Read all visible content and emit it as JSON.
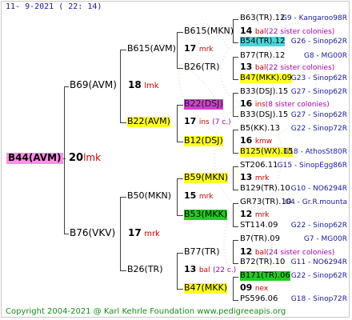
{
  "header": {
    "date": "11-  9-2021  ( 22:  14)"
  },
  "footer": {
    "copyright": "Copyright 2004-2021 @ Karl Kehrle Foundation    www.pedigreeapis.org"
  },
  "root": {
    "label": "B44(AVM)",
    "gen": {
      "num": "20",
      "abbr": "lmk"
    }
  },
  "gen1": {
    "sire": {
      "label": "B69(AVM)",
      "gen": {
        "num": "18",
        "abbr": "lmk"
      }
    },
    "dam": {
      "label": "B76(VKV)",
      "gen": {
        "num": "17",
        "abbr": "mrk"
      }
    }
  },
  "gen2": [
    {
      "label": "B615(AVM)",
      "gen": {
        "num": "17",
        "abbr": "mrk",
        "note": ""
      }
    },
    {
      "label": "B22(AVM)",
      "gen": {
        "num": "17",
        "abbr": "ins",
        "note": "(7 c.)"
      }
    },
    {
      "label": "B50(MKN)",
      "gen": {
        "num": "15",
        "abbr": "mrk",
        "note": ""
      }
    },
    {
      "label": "B26(TR)",
      "gen": {
        "num": "13",
        "abbr": "bal",
        "note": "(22 c.)"
      }
    }
  ],
  "gen3": [
    {
      "label": "B615(MKN)",
      "gen": {
        "num": "14",
        "abbr": "bal",
        "note": "(22 sister colonies)"
      }
    },
    {
      "label": "B26(TR)",
      "gen": {
        "num": "13",
        "abbr": "bal",
        "note": "(22 sister colonies)"
      }
    },
    {
      "label": "B22(DSJ)",
      "gen": {
        "num": "16",
        "abbr": "ins",
        "note": "(8 sister colonies)"
      }
    },
    {
      "label": "B12(DSJ)",
      "gen": {
        "num": "16",
        "abbr": "kmw",
        "note": ""
      }
    },
    {
      "label": "B59(MKN)",
      "gen": {
        "num": "13",
        "abbr": "mrk",
        "note": ""
      }
    },
    {
      "label": "B53(MKK)",
      "gen": {
        "num": "12",
        "abbr": "mrk",
        "note": ""
      }
    },
    {
      "label": "B77(TR)",
      "gen": {
        "num": "12",
        "abbr": "bal",
        "note": "(24 sister colonies)"
      }
    },
    {
      "label": "B47(MKK)",
      "gen": {
        "num": "09",
        "abbr": "nex",
        "note": ""
      }
    }
  ],
  "gen4": [
    {
      "name": "B63(TR).12",
      "code": "G9 - Kangaroo98R"
    },
    {
      "name": "B54(TR).12",
      "code": "G26 - Sinop62R"
    },
    {
      "name": "B77(TR).12",
      "code": "G8 - MG00R"
    },
    {
      "name": "B47(MKK).09",
      "code": "G23 - Sinop62R"
    },
    {
      "name": "B33(DSJ).15",
      "code": "G27 - Sinop62R"
    },
    {
      "name": "B33(DSJ).15",
      "code": "G27 - Sinop62R"
    },
    {
      "name": "B5(KK).13",
      "code": "G22 - Sinop72R"
    },
    {
      "name": "B125(WX).15",
      "code": "G18 - AthosSt80R"
    },
    {
      "name": "ST206.11",
      "code": "G15 - SinopEgg86R"
    },
    {
      "name": "B129(TR).10",
      "code": "G10 - NO6294R"
    },
    {
      "name": "GR73(TR).10",
      "code": "G4 - Gr.R.mounta"
    },
    {
      "name": "ST114.09",
      "code": "G22 - Sinop62R"
    },
    {
      "name": "B7(TR).09",
      "code": "G7 - MG00R"
    },
    {
      "name": "B72(TR).10",
      "code": "G11 - NO6294R"
    },
    {
      "name": "B171(TR).06",
      "code": "G22 - Sinop62R"
    },
    {
      "name": "PS596.06",
      "code": "G18 - Sinop72R"
    }
  ],
  "colors": {
    "pink": "#ff8fe8",
    "magenta": "#d040d0",
    "yellow": "#ffff22",
    "green": "#22cc22",
    "cyan": "#44d8d8",
    "codeBlue": "#1a1aa0",
    "abbrRed": "#cc0000",
    "notePurple": "#aa00aa",
    "copyGreen": "#1a8a1a"
  }
}
